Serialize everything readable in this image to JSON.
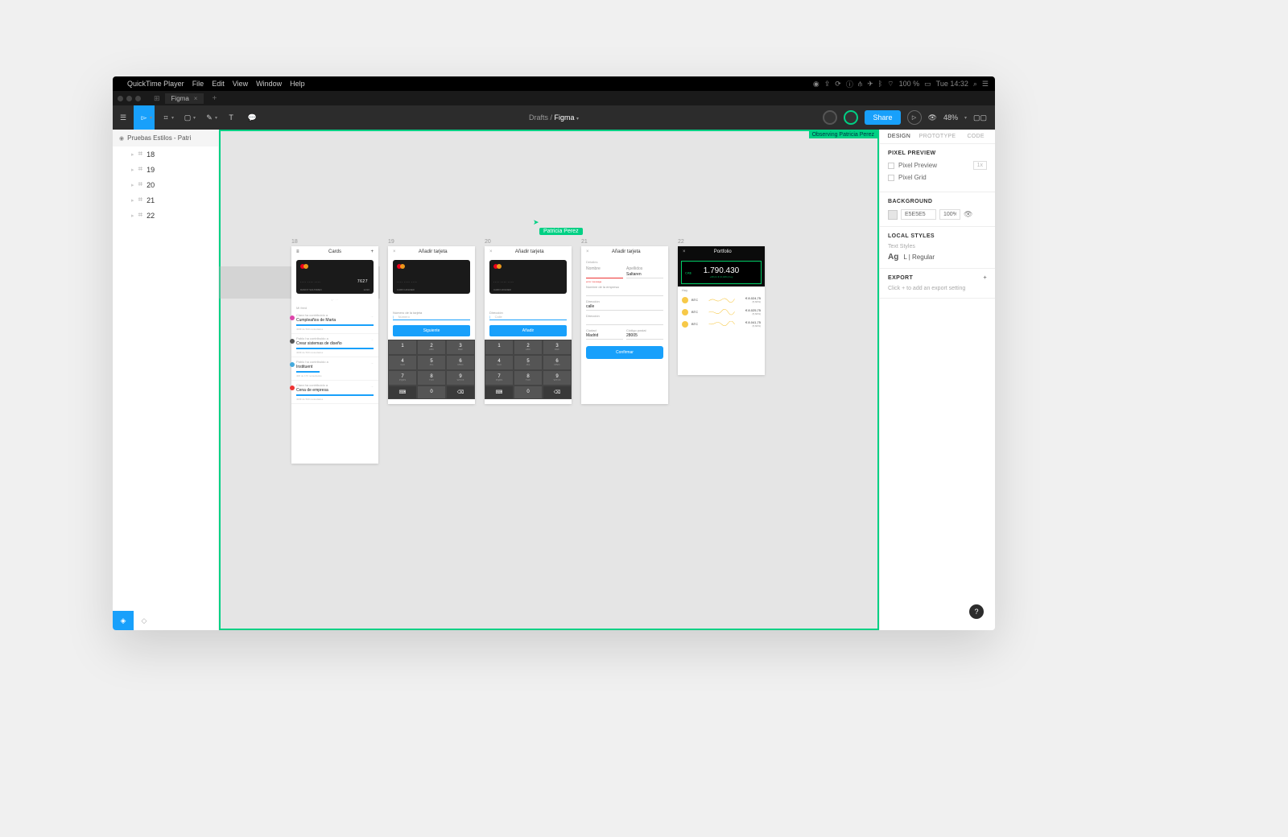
{
  "menubar": {
    "app": "QuickTime Player",
    "items": [
      "File",
      "Edit",
      "View",
      "Window",
      "Help"
    ],
    "battery": "100 %",
    "clock": "Tue 14:32"
  },
  "browser": {
    "tab": "Figma"
  },
  "toolbar": {
    "breadcrumb_parent": "Drafts",
    "breadcrumb_current": "Figma",
    "share": "Share",
    "zoom": "48%"
  },
  "layers": {
    "page": "Pruebas Estilos - Patri",
    "frames": [
      "18",
      "19",
      "20",
      "21",
      "22"
    ]
  },
  "canvas": {
    "observing": "Observing Patricia Perez",
    "cursor_user": "Patricia Perez",
    "frames": [
      {
        "id": "18",
        "title": "Cards"
      },
      {
        "id": "19",
        "title": "Añadir tarjeta"
      },
      {
        "id": "20",
        "title": "Añadir tarjeta"
      },
      {
        "id": "21",
        "title": "Añadir tarjeta"
      },
      {
        "id": "22",
        "title": "Portfolio"
      }
    ],
    "card": {
      "mask": "···· ···· ····",
      "last4": "7627",
      "name": "DANNY SALTAREN",
      "exp": "12/20"
    },
    "feed_header": "Mi feed",
    "feed": [
      {
        "pre": "Clara ha contribuido a",
        "title": "Cumpleaños de Marta",
        "sub": "400€ de 500 recaudados"
      },
      {
        "pre": "Pablo ha contribuido a",
        "title": "Crear sistemas de diseño",
        "sub": "400€ de 500 recaudados"
      },
      {
        "pre": "Pablo ha contribuido a",
        "title": "Instituent",
        "sub": "40€ de 170 recaudados"
      },
      {
        "pre": "Clara ha contribuido a",
        "title": "Cena de empresa",
        "sub": "400€ de 500 recaudados"
      }
    ],
    "frame19": {
      "label": "Número de la tarjeta",
      "placeholder": "Número",
      "btn": "Siguiente"
    },
    "frame20": {
      "label": "Dirección",
      "placeholder": "Calle",
      "btn": "Añadir"
    },
    "frame21": {
      "section": "Detalles",
      "error": "error message",
      "name_label": "Nombre",
      "surname_label": "Apellidos",
      "surname_val": "Saltaren",
      "company_label": "Nombre de la empresa",
      "address_label": "Dirección",
      "address_val": "calle",
      "city_label": "Ciudad",
      "city_val": "Madrid",
      "zip_label": "Código postal",
      "zip_val": "28005",
      "btn": "Confirmar"
    },
    "portfolio": {
      "currency": "CA$",
      "amount": "1.790.430",
      "sub": "+68,21 € (0,04%) hoy",
      "hoy": "Hoy",
      "coins": [
        {
          "sym": "BTC",
          "val": "€ 8.024,75",
          "sub": "(5,60%)"
        },
        {
          "sym": "BTC",
          "val": "€ 8.025,75",
          "sub": "(5,60%)"
        },
        {
          "sym": "BTC",
          "val": "€ 8.041,75",
          "sub": "(5,60%)"
        }
      ]
    }
  },
  "inspector": {
    "tabs": [
      "DESIGN",
      "PROTOTYPE",
      "CODE"
    ],
    "pixel_preview": "PIXEL PREVIEW",
    "pixel_preview_cb": "Pixel Preview",
    "pixel_grid_cb": "Pixel Grid",
    "scale_dd": "1x",
    "background": "BACKGROUND",
    "bg_value": "E5E5E5",
    "bg_opacity": "100%",
    "local_styles": "LOCAL STYLES",
    "text_styles": "Text Styles",
    "ag": "Ag",
    "ag_label": "L | Regular",
    "export": "EXPORT",
    "export_hint": "Click + to add an export setting"
  },
  "keypad": [
    "1",
    "2",
    "3",
    "4",
    "5",
    "6",
    "7",
    "8",
    "9",
    "",
    "0",
    ""
  ],
  "keypad_sub": [
    "",
    "ABC",
    "DEF",
    "GHI",
    "JKL",
    "MNO",
    "PQRS",
    "TUV",
    "WXYZ",
    "",
    "",
    ""
  ],
  "help": "?"
}
